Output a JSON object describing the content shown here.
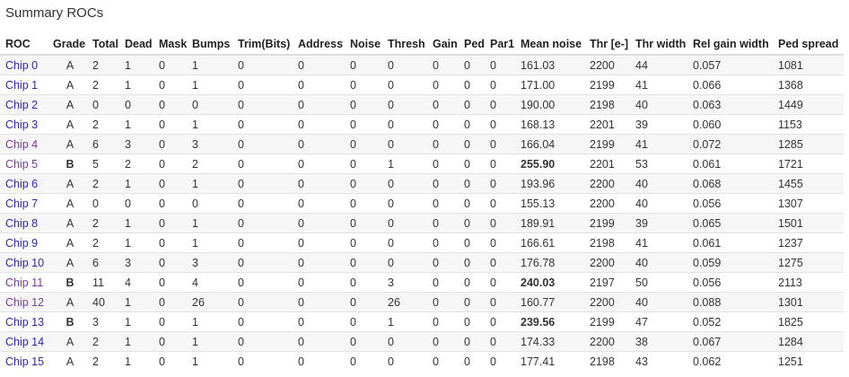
{
  "page": {
    "title": "Summary ROCs"
  },
  "colors": {
    "link": "#2a2aa8",
    "visited_link": "#7a3a9a",
    "warning": "#f08a1c",
    "stripe": "#f6f6f6"
  },
  "table": {
    "headers": [
      "ROC",
      "Grade",
      "Total",
      "Dead",
      "Mask",
      "Bumps",
      "Trim(Bits)",
      "Address",
      "Noise",
      "Thresh",
      "Gain",
      "Ped",
      "Par1",
      "Mean noise",
      "Thr [e-]",
      "Thr width",
      "Rel gain width",
      "Ped spread"
    ],
    "rows": [
      {
        "roc": "Chip 0",
        "visited": false,
        "grade": "A",
        "total": "2",
        "dead": "1",
        "mask": "0",
        "bumps": "1",
        "trim": "0",
        "address": "0",
        "noise": "0",
        "thresh": "0",
        "gain": "0",
        "ped": "0",
        "par1": "0",
        "mean_noise": "161.03",
        "mean_noise_warn": false,
        "thr": "2200",
        "thr_width": "44",
        "rel_gain_width": "0.057",
        "ped_spread": "1081"
      },
      {
        "roc": "Chip 1",
        "visited": false,
        "grade": "A",
        "total": "2",
        "dead": "1",
        "mask": "0",
        "bumps": "1",
        "trim": "0",
        "address": "0",
        "noise": "0",
        "thresh": "0",
        "gain": "0",
        "ped": "0",
        "par1": "0",
        "mean_noise": "171.00",
        "mean_noise_warn": false,
        "thr": "2199",
        "thr_width": "41",
        "rel_gain_width": "0.066",
        "ped_spread": "1368"
      },
      {
        "roc": "Chip 2",
        "visited": false,
        "grade": "A",
        "total": "0",
        "dead": "0",
        "mask": "0",
        "bumps": "0",
        "trim": "0",
        "address": "0",
        "noise": "0",
        "thresh": "0",
        "gain": "0",
        "ped": "0",
        "par1": "0",
        "mean_noise": "190.00",
        "mean_noise_warn": false,
        "thr": "2198",
        "thr_width": "40",
        "rel_gain_width": "0.063",
        "ped_spread": "1449"
      },
      {
        "roc": "Chip 3",
        "visited": false,
        "grade": "A",
        "total": "2",
        "dead": "1",
        "mask": "0",
        "bumps": "1",
        "trim": "0",
        "address": "0",
        "noise": "0",
        "thresh": "0",
        "gain": "0",
        "ped": "0",
        "par1": "0",
        "mean_noise": "168.13",
        "mean_noise_warn": false,
        "thr": "2201",
        "thr_width": "39",
        "rel_gain_width": "0.060",
        "ped_spread": "1153"
      },
      {
        "roc": "Chip 4",
        "visited": true,
        "grade": "A",
        "total": "6",
        "dead": "3",
        "mask": "0",
        "bumps": "3",
        "trim": "0",
        "address": "0",
        "noise": "0",
        "thresh": "0",
        "gain": "0",
        "ped": "0",
        "par1": "0",
        "mean_noise": "166.04",
        "mean_noise_warn": false,
        "thr": "2199",
        "thr_width": "41",
        "rel_gain_width": "0.072",
        "ped_spread": "1285"
      },
      {
        "roc": "Chip 5",
        "visited": true,
        "grade": "B",
        "total": "5",
        "dead": "2",
        "mask": "0",
        "bumps": "2",
        "trim": "0",
        "address": "0",
        "noise": "0",
        "thresh": "1",
        "gain": "0",
        "ped": "0",
        "par1": "0",
        "mean_noise": "255.90",
        "mean_noise_warn": true,
        "thr": "2201",
        "thr_width": "53",
        "rel_gain_width": "0.061",
        "ped_spread": "1721"
      },
      {
        "roc": "Chip 6",
        "visited": false,
        "grade": "A",
        "total": "2",
        "dead": "1",
        "mask": "0",
        "bumps": "1",
        "trim": "0",
        "address": "0",
        "noise": "0",
        "thresh": "0",
        "gain": "0",
        "ped": "0",
        "par1": "0",
        "mean_noise": "193.96",
        "mean_noise_warn": false,
        "thr": "2200",
        "thr_width": "40",
        "rel_gain_width": "0.068",
        "ped_spread": "1455"
      },
      {
        "roc": "Chip 7",
        "visited": false,
        "grade": "A",
        "total": "0",
        "dead": "0",
        "mask": "0",
        "bumps": "0",
        "trim": "0",
        "address": "0",
        "noise": "0",
        "thresh": "0",
        "gain": "0",
        "ped": "0",
        "par1": "0",
        "mean_noise": "155.13",
        "mean_noise_warn": false,
        "thr": "2200",
        "thr_width": "40",
        "rel_gain_width": "0.056",
        "ped_spread": "1307"
      },
      {
        "roc": "Chip 8",
        "visited": false,
        "grade": "A",
        "total": "2",
        "dead": "1",
        "mask": "0",
        "bumps": "1",
        "trim": "0",
        "address": "0",
        "noise": "0",
        "thresh": "0",
        "gain": "0",
        "ped": "0",
        "par1": "0",
        "mean_noise": "189.91",
        "mean_noise_warn": false,
        "thr": "2199",
        "thr_width": "39",
        "rel_gain_width": "0.065",
        "ped_spread": "1501"
      },
      {
        "roc": "Chip 9",
        "visited": false,
        "grade": "A",
        "total": "2",
        "dead": "1",
        "mask": "0",
        "bumps": "1",
        "trim": "0",
        "address": "0",
        "noise": "0",
        "thresh": "0",
        "gain": "0",
        "ped": "0",
        "par1": "0",
        "mean_noise": "166.61",
        "mean_noise_warn": false,
        "thr": "2198",
        "thr_width": "41",
        "rel_gain_width": "0.061",
        "ped_spread": "1237"
      },
      {
        "roc": "Chip 10",
        "visited": false,
        "grade": "A",
        "total": "6",
        "dead": "3",
        "mask": "0",
        "bumps": "3",
        "trim": "0",
        "address": "0",
        "noise": "0",
        "thresh": "0",
        "gain": "0",
        "ped": "0",
        "par1": "0",
        "mean_noise": "176.78",
        "mean_noise_warn": false,
        "thr": "2200",
        "thr_width": "40",
        "rel_gain_width": "0.059",
        "ped_spread": "1275"
      },
      {
        "roc": "Chip 11",
        "visited": true,
        "grade": "B",
        "total": "11",
        "dead": "4",
        "mask": "0",
        "bumps": "4",
        "trim": "0",
        "address": "0",
        "noise": "0",
        "thresh": "3",
        "gain": "0",
        "ped": "0",
        "par1": "0",
        "mean_noise": "240.03",
        "mean_noise_warn": true,
        "thr": "2197",
        "thr_width": "50",
        "rel_gain_width": "0.056",
        "ped_spread": "2113"
      },
      {
        "roc": "Chip 12",
        "visited": true,
        "grade": "A",
        "total": "40",
        "dead": "1",
        "mask": "0",
        "bumps": "26",
        "trim": "0",
        "address": "0",
        "noise": "0",
        "thresh": "26",
        "gain": "0",
        "ped": "0",
        "par1": "0",
        "mean_noise": "160.77",
        "mean_noise_warn": false,
        "thr": "2200",
        "thr_width": "40",
        "rel_gain_width": "0.088",
        "ped_spread": "1301"
      },
      {
        "roc": "Chip 13",
        "visited": false,
        "grade": "B",
        "total": "3",
        "dead": "1",
        "mask": "0",
        "bumps": "1",
        "trim": "0",
        "address": "0",
        "noise": "0",
        "thresh": "1",
        "gain": "0",
        "ped": "0",
        "par1": "0",
        "mean_noise": "239.56",
        "mean_noise_warn": true,
        "thr": "2199",
        "thr_width": "47",
        "rel_gain_width": "0.052",
        "ped_spread": "1825"
      },
      {
        "roc": "Chip 14",
        "visited": false,
        "grade": "A",
        "total": "2",
        "dead": "1",
        "mask": "0",
        "bumps": "1",
        "trim": "0",
        "address": "0",
        "noise": "0",
        "thresh": "0",
        "gain": "0",
        "ped": "0",
        "par1": "0",
        "mean_noise": "174.33",
        "mean_noise_warn": false,
        "thr": "2200",
        "thr_width": "38",
        "rel_gain_width": "0.067",
        "ped_spread": "1284"
      },
      {
        "roc": "Chip 15",
        "visited": false,
        "grade": "A",
        "total": "2",
        "dead": "1",
        "mask": "0",
        "bumps": "1",
        "trim": "0",
        "address": "0",
        "noise": "0",
        "thresh": "0",
        "gain": "0",
        "ped": "0",
        "par1": "0",
        "mean_noise": "177.41",
        "mean_noise_warn": false,
        "thr": "2198",
        "thr_width": "43",
        "rel_gain_width": "0.062",
        "ped_spread": "1251"
      }
    ]
  }
}
